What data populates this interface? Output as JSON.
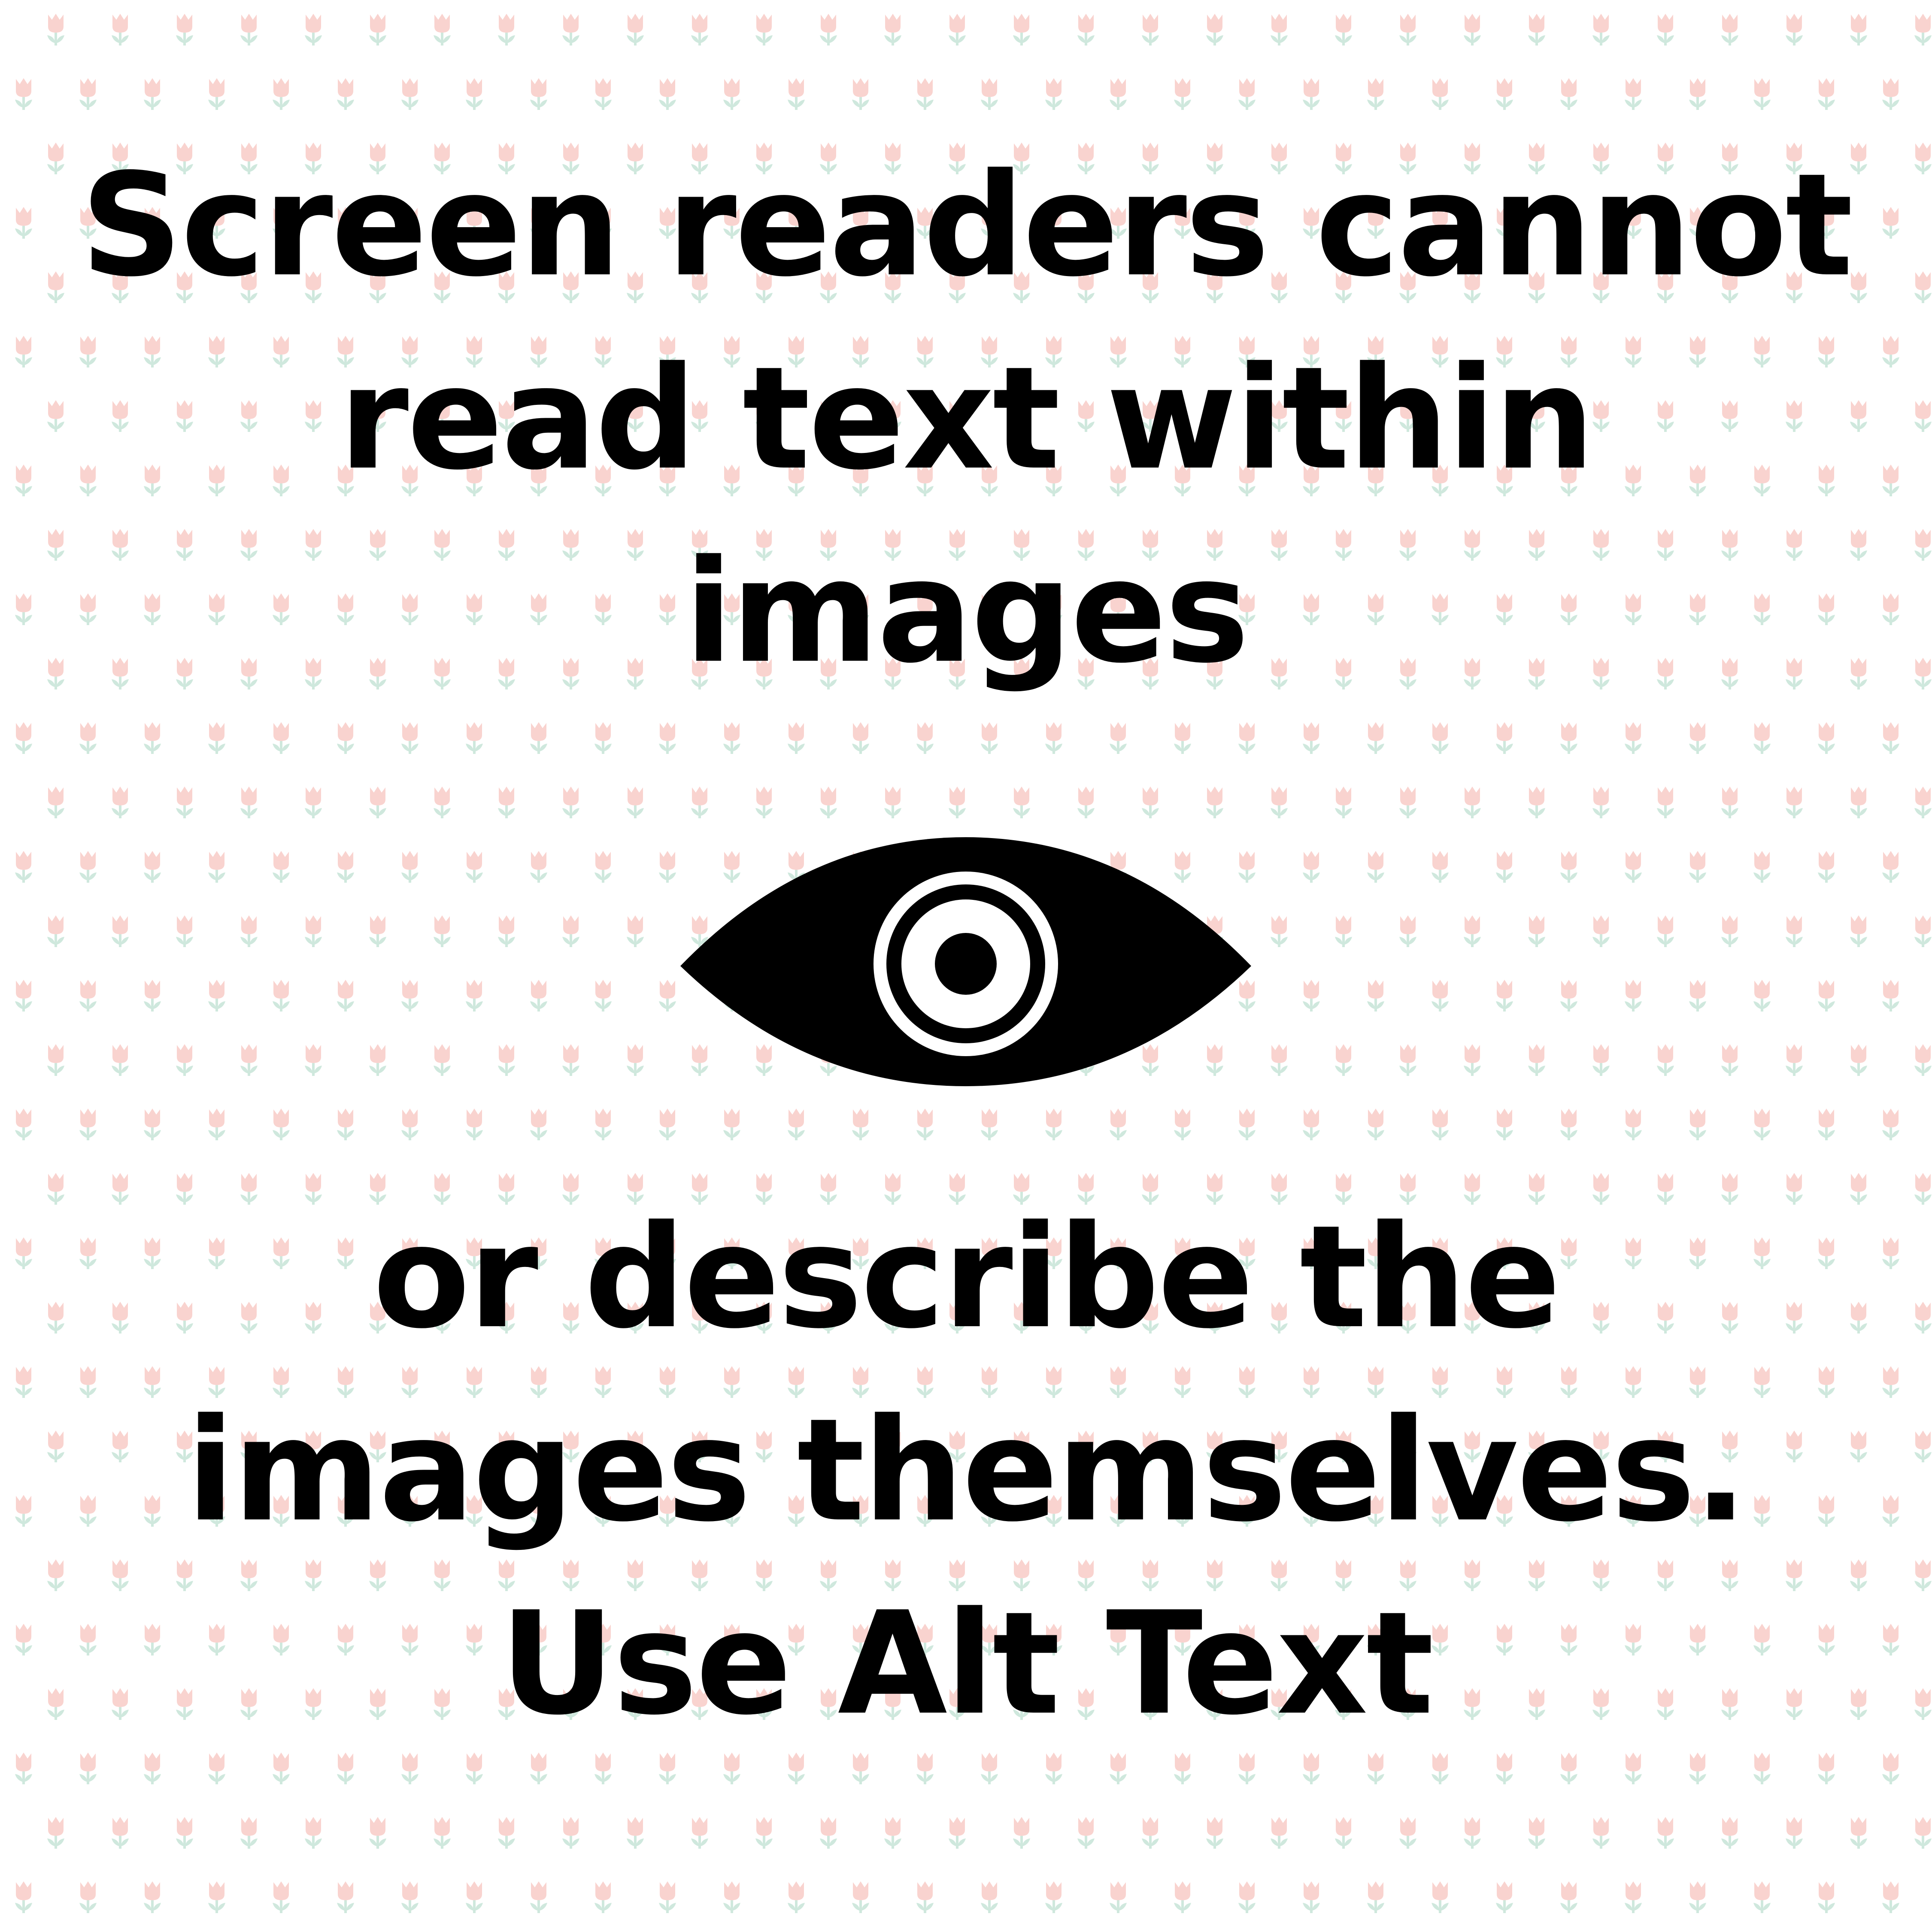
{
  "message": {
    "top_lines": [
      "Screen readers cannot",
      "read text within",
      "images"
    ],
    "bottom_lines": [
      "or describe the",
      "images themselves.",
      "Use Alt Text"
    ]
  },
  "icon": "eye-icon",
  "colors": {
    "background": "#ffffff",
    "text": "#000000",
    "tulip_bloom": "#f9d3cf",
    "tulip_stem": "#cfe8dd"
  }
}
